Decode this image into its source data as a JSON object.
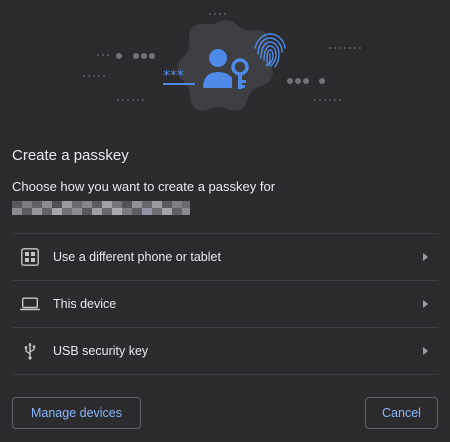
{
  "dialog": {
    "title": "Create a passkey",
    "subtitle": "Choose how you want to create a passkey for"
  },
  "options": [
    {
      "label": "Use a different phone or tablet",
      "icon": "qr-code-icon"
    },
    {
      "label": "This device",
      "icon": "laptop-icon"
    },
    {
      "label": "USB security key",
      "icon": "usb-icon"
    }
  ],
  "buttons": {
    "manage": "Manage devices",
    "cancel": "Cancel"
  },
  "colors": {
    "background": "#2b2b2e",
    "accent": "#8ab4f8",
    "illustration_blue": "#4f8ae8"
  }
}
